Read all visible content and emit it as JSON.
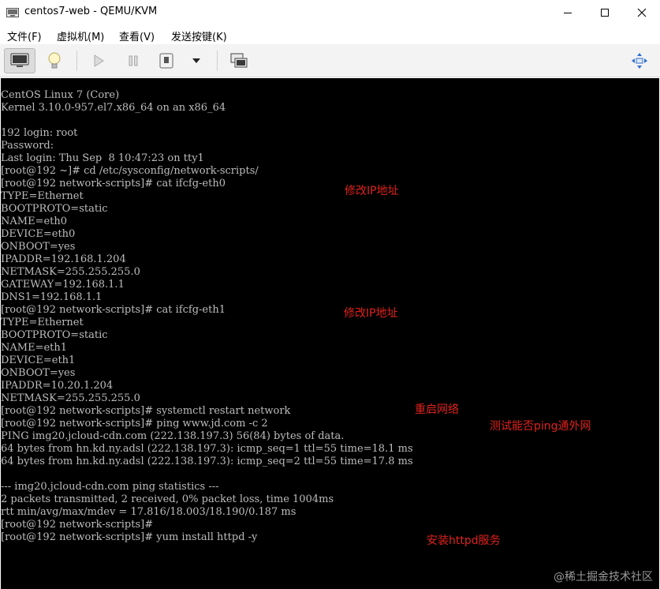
{
  "window": {
    "title": "centos7-web - QEMU/KVM"
  },
  "menu": [
    "文件(F)",
    "虚拟机(M)",
    "查看(V)",
    "发送按键(K)"
  ],
  "toolbar": {
    "icons": [
      "console-monitor-icon",
      "details-lightbulb-icon",
      "run-icon",
      "pause-icon",
      "shutdown-icon",
      "shutdown-dropdown-icon",
      "snapshots-icon",
      "resize-to-vm-icon"
    ]
  },
  "console": {
    "lines": [
      "CentOS Linux 7 (Core)",
      "Kernel 3.10.0-957.el7.x86_64 on an x86_64",
      "",
      "192 login: root",
      "Password:",
      "Last login: Thu Sep  8 10:47:23 on tty1",
      "[root@192 ~]# cd /etc/sysconfig/network-scripts/",
      "[root@192 network-scripts]# cat ifcfg-eth0",
      "TYPE=Ethernet",
      "BOOTPROTO=static",
      "NAME=eth0",
      "DEVICE=eth0",
      "ONBOOT=yes",
      "IPADDR=192.168.1.204",
      "NETMASK=255.255.255.0",
      "GATEWAY=192.168.1.1",
      "DNS1=192.168.1.1",
      "[root@192 network-scripts]# cat ifcfg-eth1",
      "TYPE=Ethernet",
      "BOOTPROTO=static",
      "NAME=eth1",
      "DEVICE=eth1",
      "ONBOOT=yes",
      "IPADDR=10.20.1.204",
      "NETMASK=255.255.255.0",
      "[root@192 network-scripts]# systemctl restart network",
      "[root@192 network-scripts]# ping www.jd.com -c 2",
      "PING img20.jcloud-cdn.com (222.138.197.3) 56(84) bytes of data.",
      "64 bytes from hn.kd.ny.adsl (222.138.197.3): icmp_seq=1 ttl=55 time=18.1 ms",
      "64 bytes from hn.kd.ny.adsl (222.138.197.3): icmp_seq=2 ttl=55 time=17.8 ms",
      "",
      "--- img20.jcloud-cdn.com ping statistics ---",
      "2 packets transmitted, 2 received, 0% packet loss, time 1004ms",
      "rtt min/avg/max/mdev = 17.816/18.003/18.190/0.187 ms",
      "[root@192 network-scripts]#",
      "[root@192 network-scripts]# yum install httpd -y"
    ]
  },
  "annotations": [
    "修改IP地址",
    "修改IP地址",
    "重启网络",
    "测试能否ping通外网",
    "安装httpd服务"
  ],
  "watermark": "@稀土掘金技术社区",
  "colors": {
    "console_bg": "#000000",
    "console_text": "#bdbdbd",
    "annotation": "#e0221d"
  }
}
